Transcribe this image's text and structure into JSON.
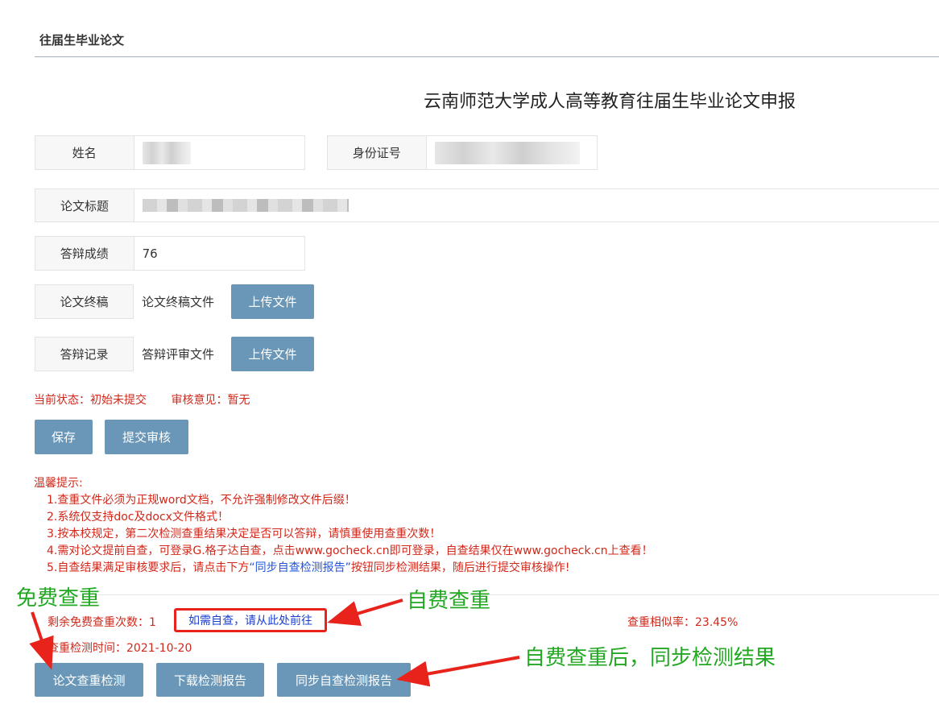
{
  "section": {
    "title": "往届生毕业论文"
  },
  "page_title": "云南师范大学成人高等教育往届生毕业论文申报",
  "form": {
    "name_label": "姓名",
    "id_label": "身份证号",
    "thesis_title_label": "论文标题",
    "defense_score_label": "答辩成绩",
    "defense_score_value": "76",
    "final_draft_label": "论文终稿",
    "final_draft_file": "论文终稿文件",
    "defense_record_label": "答辩记录",
    "defense_record_file": "答辩评审文件",
    "upload_label": "上传文件"
  },
  "status": {
    "current": "当前状态：初始未提交",
    "review": "审核意见：暂无"
  },
  "actions": {
    "save": "保存",
    "submit": "提交审核"
  },
  "tips": {
    "heading": "温馨提示:",
    "items": [
      "1.查重文件必须为正规word文档，不允许强制修改文件后缀！",
      "2.系统仅支持doc及docx文件格式！",
      "3.按本校规定，第二次检测查重结果决定是否可以答辩，请慎重使用查重次数！",
      "4.需对论文提前自查，可登录G.格子达自查，点击www.gocheck.cn即可登录，自查结果仅在www.gocheck.cn上查看！"
    ],
    "item5_before": "5.自查结果满足审核要求后，请点击下方",
    "item5_link": "“同步自查检测报告”",
    "item5_after": "按钮同步检测结果，随后进行提交审核操作!"
  },
  "check": {
    "remaining": "剩余免费查重次数：1",
    "self_check_link": "如需自查，请从此处前往",
    "similarity": "查重相似率：23.45%",
    "time": "查重检测时间：2021-10-20",
    "btn_check": "论文查重检测",
    "btn_download": "下载检测报告",
    "btn_sync": "同步自查检测报告"
  },
  "annotations": {
    "free_check": "免费查重",
    "paid_check": "自费查重",
    "sync_after": "自费查重后，同步检测结果",
    "color": "#22a822",
    "arrow_color": "#e8231b"
  },
  "colors": {
    "button": "#6a97b8",
    "alert_text": "#d0281b",
    "link": "#2255dd"
  }
}
